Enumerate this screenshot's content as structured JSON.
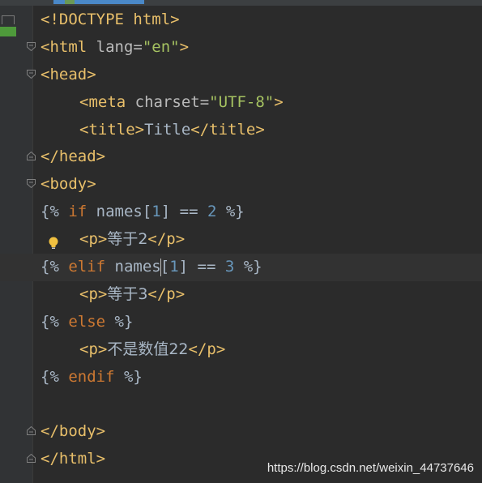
{
  "editor": {
    "lines": [
      {
        "parts": [
          {
            "t": "<!DOCTYPE html>",
            "c": "tag"
          }
        ]
      },
      {
        "parts": [
          {
            "t": "<html ",
            "c": "tag"
          },
          {
            "t": "lang=",
            "c": "attr"
          },
          {
            "t": "\"en\"",
            "c": "str"
          },
          {
            "t": ">",
            "c": "tag"
          }
        ],
        "fold": "open"
      },
      {
        "parts": [
          {
            "t": "<head>",
            "c": "tag"
          }
        ],
        "fold": "open"
      },
      {
        "indent": true,
        "parts": [
          {
            "t": "<meta ",
            "c": "tag"
          },
          {
            "t": "charset=",
            "c": "attr"
          },
          {
            "t": "\"UTF-8\"",
            "c": "str"
          },
          {
            "t": ">",
            "c": "tag"
          }
        ]
      },
      {
        "indent": true,
        "parts": [
          {
            "t": "<title>",
            "c": "tag"
          },
          {
            "t": "Title",
            "c": "plain"
          },
          {
            "t": "</title>",
            "c": "tag"
          }
        ]
      },
      {
        "parts": [
          {
            "t": "</head>",
            "c": "tag"
          }
        ],
        "fold": "close"
      },
      {
        "parts": [
          {
            "t": "<body>",
            "c": "tag"
          }
        ],
        "fold": "open"
      },
      {
        "parts": [
          {
            "t": "{% ",
            "c": "plain"
          },
          {
            "t": "if",
            "c": "kw"
          },
          {
            "t": " names[",
            "c": "plain"
          },
          {
            "t": "1",
            "c": "num"
          },
          {
            "t": "] == ",
            "c": "plain"
          },
          {
            "t": "2",
            "c": "num"
          },
          {
            "t": " %}",
            "c": "plain"
          }
        ]
      },
      {
        "indent": true,
        "bulb": true,
        "parts": [
          {
            "t": "<p>",
            "c": "tag"
          },
          {
            "t": "等于2",
            "c": "cjk"
          },
          {
            "t": "</p>",
            "c": "tag"
          }
        ]
      },
      {
        "current": true,
        "parts": [
          {
            "t": "{% ",
            "c": "plain"
          },
          {
            "t": "elif",
            "c": "kw"
          },
          {
            "t": " names",
            "c": "plain"
          },
          {
            "t": "|caret|",
            "c": "caret"
          },
          {
            "t": "[",
            "c": "plain"
          },
          {
            "t": "1",
            "c": "num"
          },
          {
            "t": "] == ",
            "c": "plain"
          },
          {
            "t": "3",
            "c": "num"
          },
          {
            "t": " %}",
            "c": "plain"
          }
        ]
      },
      {
        "indent": true,
        "parts": [
          {
            "t": "<p>",
            "c": "tag"
          },
          {
            "t": "等于3",
            "c": "cjk"
          },
          {
            "t": "</p>",
            "c": "tag"
          }
        ]
      },
      {
        "parts": [
          {
            "t": "{% ",
            "c": "plain"
          },
          {
            "t": "else",
            "c": "kw"
          },
          {
            "t": " %}",
            "c": "plain"
          }
        ]
      },
      {
        "indent": true,
        "parts": [
          {
            "t": "<p>",
            "c": "tag"
          },
          {
            "t": "不是数值22",
            "c": "cjk"
          },
          {
            "t": "</p>",
            "c": "tag"
          }
        ]
      },
      {
        "parts": [
          {
            "t": "{% ",
            "c": "plain"
          },
          {
            "t": "endif",
            "c": "kw"
          },
          {
            "t": " %}",
            "c": "plain"
          }
        ]
      },
      {
        "parts": []
      },
      {
        "parts": [
          {
            "t": "</body>",
            "c": "tag"
          }
        ],
        "fold": "close"
      },
      {
        "parts": [
          {
            "t": "</html>",
            "c": "tag"
          }
        ],
        "fold": "close"
      }
    ]
  },
  "watermark": "https://blog.csdn.net/weixin_44737646",
  "colors": {
    "tag": "#e8bf6a",
    "string": "#a5c261",
    "keyword": "#cc7832",
    "number": "#6897bb",
    "text": "#a9b7c6",
    "background": "#2b2b2b",
    "gutter": "#313335"
  },
  "icons": {
    "fold_open": "fold-open-icon",
    "fold_close": "fold-close-icon",
    "intention": "lightbulb-icon"
  }
}
